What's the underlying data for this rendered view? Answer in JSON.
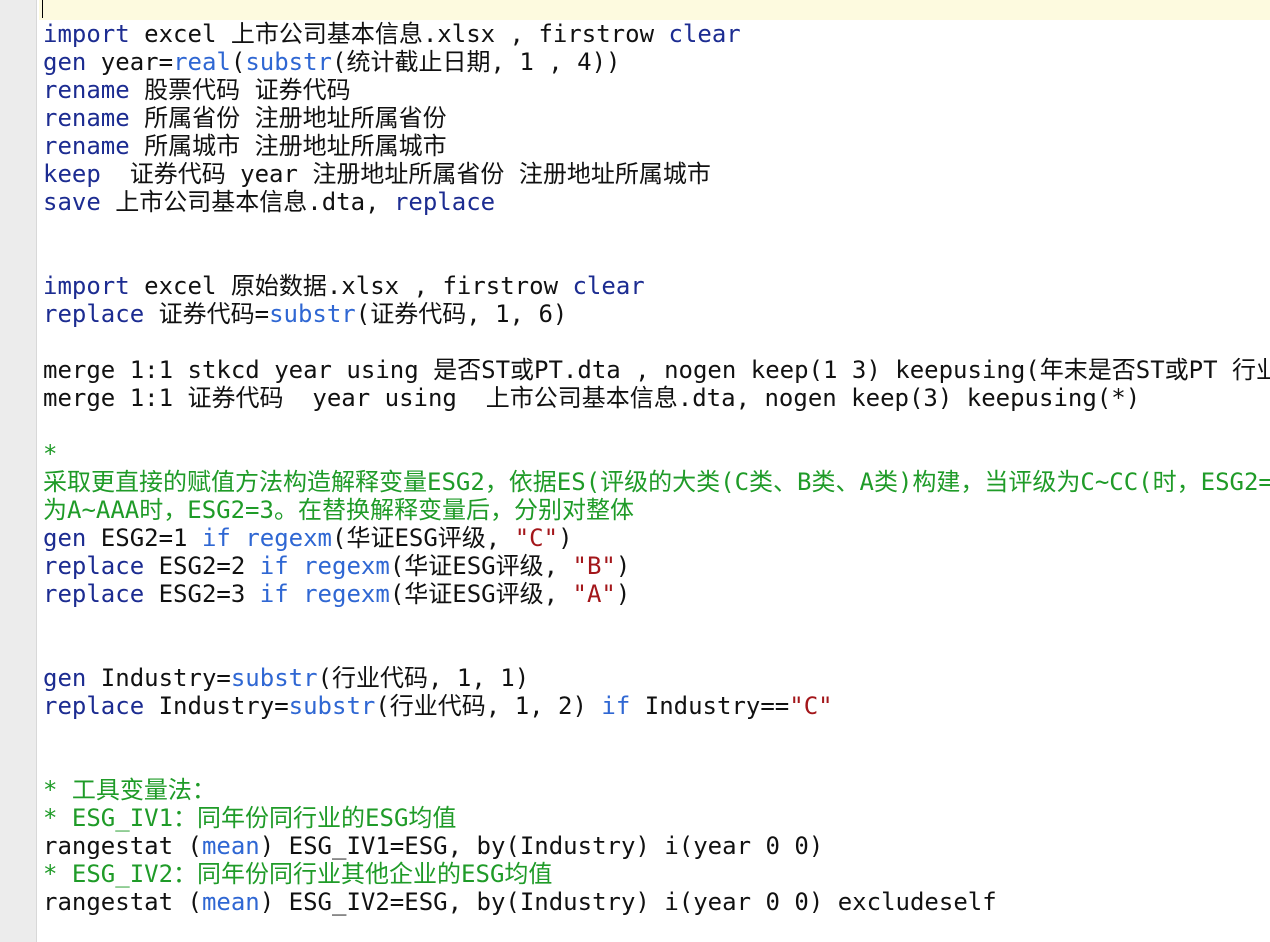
{
  "editor": {
    "colors": {
      "current_line": "#fdfadf",
      "syntax": {
        "plain": "#111111",
        "command": "#1c2c91",
        "option": "#1c2c91",
        "function": "#2f67d3",
        "keyword": "#2f67d3",
        "string": "#a3161a",
        "comment": "#1f9b28"
      }
    },
    "lines": [
      {
        "current": true,
        "tokens": []
      },
      {
        "tokens": [
          {
            "kind": "command",
            "text": "import"
          },
          {
            "text": " excel 上市公司基本信息.xlsx , firstrow "
          },
          {
            "kind": "option",
            "text": "clear"
          }
        ]
      },
      {
        "tokens": [
          {
            "kind": "command",
            "text": "gen"
          },
          {
            "text": " year="
          },
          {
            "kind": "function",
            "text": "real"
          },
          {
            "text": "("
          },
          {
            "kind": "function",
            "text": "substr"
          },
          {
            "text": "(统计截止日期, 1 , 4))"
          }
        ]
      },
      {
        "tokens": [
          {
            "kind": "command",
            "text": "rename"
          },
          {
            "text": " 股票代码 证券代码"
          }
        ]
      },
      {
        "tokens": [
          {
            "kind": "command",
            "text": "rename"
          },
          {
            "text": " 所属省份 注册地址所属省份"
          }
        ]
      },
      {
        "tokens": [
          {
            "kind": "command",
            "text": "rename"
          },
          {
            "text": " 所属城市 注册地址所属城市"
          }
        ]
      },
      {
        "tokens": [
          {
            "kind": "command",
            "text": "keep"
          },
          {
            "text": "  证券代码 year 注册地址所属省份 注册地址所属城市"
          }
        ]
      },
      {
        "tokens": [
          {
            "kind": "command",
            "text": "save"
          },
          {
            "text": " 上市公司基本信息.dta, "
          },
          {
            "kind": "option",
            "text": "replace"
          }
        ]
      },
      {
        "tokens": []
      },
      {
        "tokens": []
      },
      {
        "tokens": [
          {
            "kind": "command",
            "text": "import"
          },
          {
            "text": " excel 原始数据.xlsx , firstrow "
          },
          {
            "kind": "option",
            "text": "clear"
          }
        ]
      },
      {
        "tokens": [
          {
            "kind": "command",
            "text": "replace"
          },
          {
            "text": " 证券代码="
          },
          {
            "kind": "function",
            "text": "substr"
          },
          {
            "text": "(证券代码, 1, 6)"
          }
        ]
      },
      {
        "tokens": []
      },
      {
        "tokens": [
          {
            "text": "merge 1:1 stkcd year using 是否ST或PT.dta , nogen keep(1 3) keepusing(年末是否ST或PT 行业"
          }
        ]
      },
      {
        "tokens": [
          {
            "text": "merge 1:1 证券代码  year using  上市公司基本信息.dta, nogen keep(3) keepusing(*)"
          }
        ]
      },
      {
        "tokens": []
      },
      {
        "tokens": [
          {
            "kind": "comment",
            "text": "*"
          }
        ]
      },
      {
        "tokens": [
          {
            "kind": "comment",
            "text": "采取更直接的赋值方法构造解释变量ESG2，依据ES(评级的大类(C类、B类、A类)构建，当评级为C~CC(时，ESG2="
          }
        ]
      },
      {
        "tokens": [
          {
            "kind": "comment",
            "text": "为A~AAA时，ESG2=3。在替换解释变量后，分别对整体"
          }
        ]
      },
      {
        "tokens": [
          {
            "kind": "command",
            "text": "gen"
          },
          {
            "text": " ESG2=1 "
          },
          {
            "kind": "keyword",
            "text": "if"
          },
          {
            "text": " "
          },
          {
            "kind": "function",
            "text": "regexm"
          },
          {
            "text": "(华证ESG评级, "
          },
          {
            "kind": "string",
            "text": "\"C\""
          },
          {
            "text": ")"
          }
        ]
      },
      {
        "tokens": [
          {
            "kind": "command",
            "text": "replace"
          },
          {
            "text": " ESG2=2 "
          },
          {
            "kind": "keyword",
            "text": "if"
          },
          {
            "text": " "
          },
          {
            "kind": "function",
            "text": "regexm"
          },
          {
            "text": "(华证ESG评级, "
          },
          {
            "kind": "string",
            "text": "\"B\""
          },
          {
            "text": ")"
          }
        ]
      },
      {
        "tokens": [
          {
            "kind": "command",
            "text": "replace"
          },
          {
            "text": " ESG2=3 "
          },
          {
            "kind": "keyword",
            "text": "if"
          },
          {
            "text": " "
          },
          {
            "kind": "function",
            "text": "regexm"
          },
          {
            "text": "(华证ESG评级, "
          },
          {
            "kind": "string",
            "text": "\"A\""
          },
          {
            "text": ")"
          }
        ]
      },
      {
        "tokens": []
      },
      {
        "tokens": []
      },
      {
        "tokens": [
          {
            "kind": "command",
            "text": "gen"
          },
          {
            "text": " Industry="
          },
          {
            "kind": "function",
            "text": "substr"
          },
          {
            "text": "(行业代码, 1, 1)"
          }
        ]
      },
      {
        "tokens": [
          {
            "kind": "command",
            "text": "replace"
          },
          {
            "text": " Industry="
          },
          {
            "kind": "function",
            "text": "substr"
          },
          {
            "text": "(行业代码, 1, 2) "
          },
          {
            "kind": "keyword",
            "text": "if"
          },
          {
            "text": " Industry=="
          },
          {
            "kind": "string",
            "text": "\"C\""
          }
        ]
      },
      {
        "tokens": []
      },
      {
        "tokens": []
      },
      {
        "tokens": [
          {
            "kind": "comment",
            "text": "* 工具变量法："
          }
        ]
      },
      {
        "tokens": [
          {
            "kind": "comment",
            "text": "* ESG_IV1：同年份同行业的ESG均值"
          }
        ]
      },
      {
        "tokens": [
          {
            "text": "rangestat ("
          },
          {
            "kind": "function",
            "text": "mean"
          },
          {
            "text": ") ESG_IV1=ESG, by(Industry) i(year 0 0)"
          }
        ]
      },
      {
        "tokens": [
          {
            "kind": "comment",
            "text": "* ESG_IV2：同年份同行业其他企业的ESG均值"
          }
        ]
      },
      {
        "tokens": [
          {
            "text": "rangestat ("
          },
          {
            "kind": "function",
            "text": "mean"
          },
          {
            "text": ") ESG_IV2=ESG, by(Industry) i(year 0 0) excludeself"
          }
        ]
      },
      {
        "tokens": []
      }
    ]
  }
}
